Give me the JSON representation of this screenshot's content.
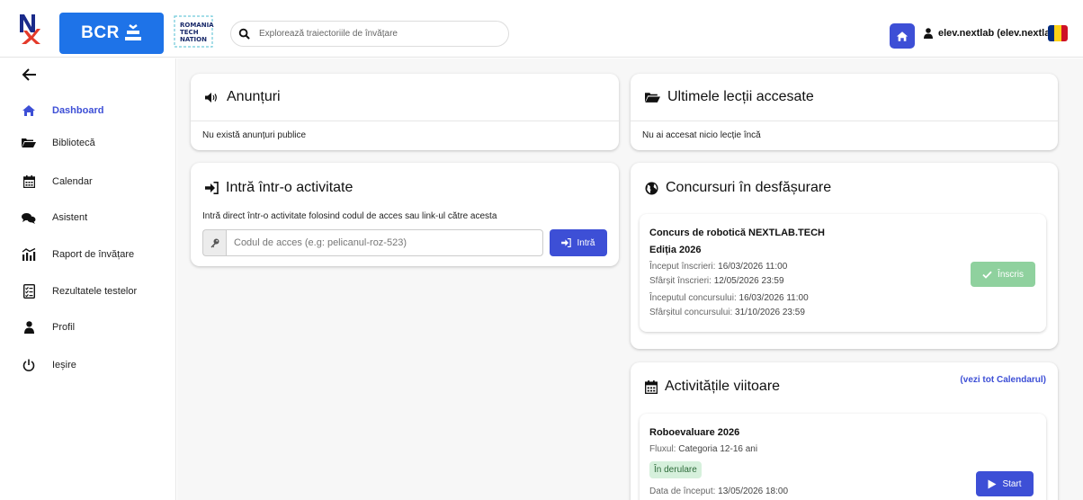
{
  "header": {
    "logo_text": "BCR",
    "search_placeholder": "Explorează traiectoriile de învățare",
    "username": "elev.nextlab (elev.nextlab)",
    "accent_color": "#3d4fd6"
  },
  "sidebar": {
    "items": [
      {
        "label": "Dashboard",
        "icon": "home-icon",
        "active": true
      },
      {
        "label": "Bibliotecă",
        "icon": "folder-open-icon",
        "active": false
      },
      {
        "label": "Calendar",
        "icon": "calendar-icon",
        "active": false
      },
      {
        "label": "Asistent",
        "icon": "comments-icon",
        "active": false
      },
      {
        "label": "Raport de învățare",
        "icon": "chart-icon",
        "active": false
      },
      {
        "label": "Rezultatele testelor",
        "icon": "test-list-icon",
        "active": false
      },
      {
        "label": "Profil",
        "icon": "user-icon",
        "active": false
      },
      {
        "label": "Ieșire",
        "icon": "power-icon",
        "active": false
      }
    ]
  },
  "announcements": {
    "title": "Anunțuri",
    "empty_text": "Nu există anunțuri publice"
  },
  "join_activity": {
    "title": "Intră într-o activitate",
    "description": "Intră direct într-o activitate folosind codul de acces sau link-ul către acesta",
    "input_placeholder": "Codul de acces (e.g: pelicanul-roz-523)",
    "button_label": "Intră"
  },
  "recent_lessons": {
    "title": "Ultimele lecții accesate",
    "empty_text": "Nu ai accesat nicio lecție încă"
  },
  "contests": {
    "title": "Concursuri în desfășurare",
    "items": [
      {
        "name": "Concurs de robotică NEXTLAB.TECH",
        "edition": "Ediția 2026",
        "registration_start_label": "Început înscrieri:",
        "registration_start": "16/03/2026 11:00",
        "registration_end_label": "Sfârșit înscrieri:",
        "registration_end": "12/05/2026 23:59",
        "contest_start_label": "Începutul concursului:",
        "contest_start": "16/03/2026 11:00",
        "contest_end_label": "Sfârșitul concursului:",
        "contest_end": "31/10/2026 23:59",
        "status_button": "Înscris"
      }
    ]
  },
  "upcoming": {
    "title": "Activitățile viitoare",
    "calendar_link": "(vezi tot Calendarul)",
    "items": [
      {
        "name": "Roboevaluare 2026",
        "flow_label": "Fluxul:",
        "flow_value": "Categoria 12-16 ani",
        "status": "În derulare",
        "start_label": "Data de început:",
        "start_value": "13/05/2026 18:00",
        "button_label": "Start"
      }
    ]
  }
}
